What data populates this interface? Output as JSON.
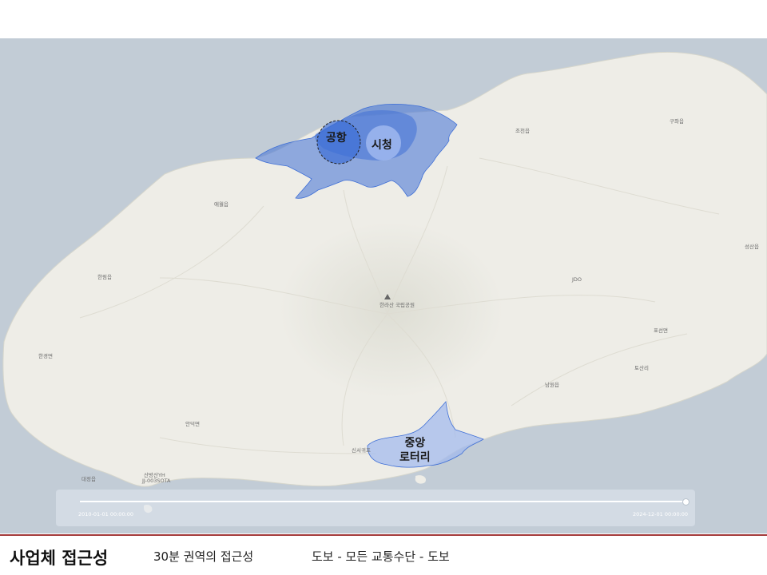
{
  "footer": {
    "title": "사업체 접근성",
    "subtitle": "30분 권역의 접근성",
    "mode": "도보 - 모든 교통수단 - 도보"
  },
  "map": {
    "colors": {
      "sea": "#c2ccd6",
      "land": "#eeede7",
      "isochrone": "#3f6fd6",
      "poi_circle": "#9fb8ee"
    },
    "places": [
      {
        "id": "jocheon",
        "name": "조천읍"
      },
      {
        "id": "guja",
        "name": "구좌읍"
      },
      {
        "id": "aewol",
        "name": "애월읍"
      },
      {
        "id": "seongsan",
        "name": "성산읍"
      },
      {
        "id": "hallim",
        "name": "한림읍"
      },
      {
        "id": "hallasan",
        "name": "한라산 국립공원"
      },
      {
        "id": "hangyeong",
        "name": "한경면"
      },
      {
        "id": "pyoseon",
        "name": "표선면"
      },
      {
        "id": "tosalli",
        "name": "토산리"
      },
      {
        "id": "namwon",
        "name": "남원읍"
      },
      {
        "id": "andeok",
        "name": "안덕면"
      },
      {
        "id": "daejeong",
        "name": "대정읍"
      },
      {
        "id": "sinseogwipo",
        "name": "신서귀포"
      },
      {
        "id": "jdo",
        "name": "JDO"
      },
      {
        "id": "sanbang",
        "name": "산방산YH"
      },
      {
        "id": "sanbang2",
        "name": "JJ-003SOTA"
      }
    ],
    "pois": {
      "airport": "공항",
      "city_hall": "시청",
      "rotary": "중앙\n로터리"
    },
    "timeline": {
      "start": "2010-01-01 00:00:00",
      "end": "2024-12-01 00:00:00",
      "progress": 0.99
    }
  }
}
